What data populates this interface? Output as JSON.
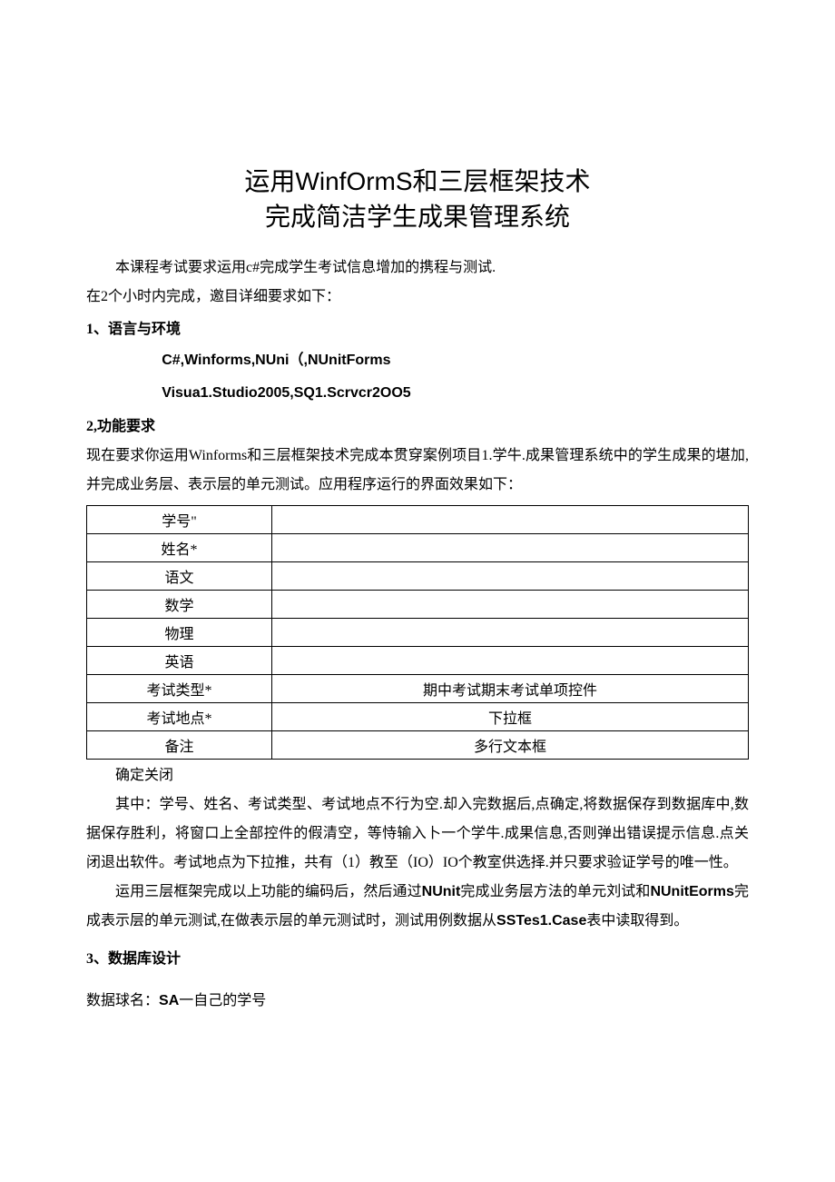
{
  "title_line1_a": "运用",
  "title_line1_b": "WinfOrmS",
  "title_line1_c": "和三层框架技术",
  "title_line2": "完成简洁学生成果管理系统",
  "intro": "本课程考试要求运用c#完成学生考试信息增加的携程与测试.",
  "time_req": "在2个小时内完成，邀目详细要求如下：",
  "sec1_head": "1、语言与环境",
  "code1": "C#,Winforms,NUni（,NUnitForms",
  "code2": "Visua1.Studio2005,SQ1.Scrvcr2OO5",
  "sec2_head": "2,功能要求",
  "sec2_p1": "现在要求你运用Winforms和三层框架技术完成本贯穿案例项目1.学牛.成果管理系统中的学生成果的堪加,并完成业务层、表示层的单元测试。应用程序运行的界面效果如下：",
  "table": {
    "rows": [
      {
        "label": "学号\"",
        "value": ""
      },
      {
        "label": "姓名*",
        "value": ""
      },
      {
        "label": "语文",
        "value": ""
      },
      {
        "label": "数学",
        "value": ""
      },
      {
        "label": "物理",
        "value": ""
      },
      {
        "label": "英语",
        "value": ""
      },
      {
        "label": "考试类型*",
        "value": "期中考试期末考试单项控件"
      },
      {
        "label": "考试地点*",
        "value": "下拉框"
      },
      {
        "label": "备注",
        "value": "多行文本框"
      }
    ]
  },
  "below_table": "确定关闭",
  "sec2_p2": "其中：学号、姓名、考试类型、考试地点不行为空.却入完数据后,点确定,将数据保存到数据库中,数据保存胜利，将窗口上全部控件的假清空，等恃输入卜一个学牛.成果信息,否则弹出错误提示信息.点关闭退出软件。考试地点为下拉推，共有（1）教至（IO）IO个教室供选择.并只要求验证学号的唯一性。",
  "sec2_p3a": "运用三层框架完成以上功能的编码后，然后通过",
  "sec2_p3a_bold": "NUnit",
  "sec2_p3b": "完成业务层方法的单元刘试和",
  "sec2_p3c_bold": "NUnitEorms",
  "sec2_p3c": "完成表示层的单元测试,在做表示层的单元测试时，测试用例数据从",
  "sec2_p3d_bold": "SSTes1.Case",
  "sec2_p3d": "表中读取得到。",
  "sec3_head": "3、数据库设计",
  "sec3_p1a": "数据球名：",
  "sec3_p1b_bold": "SA",
  "sec3_p1b": "一自己的学号"
}
